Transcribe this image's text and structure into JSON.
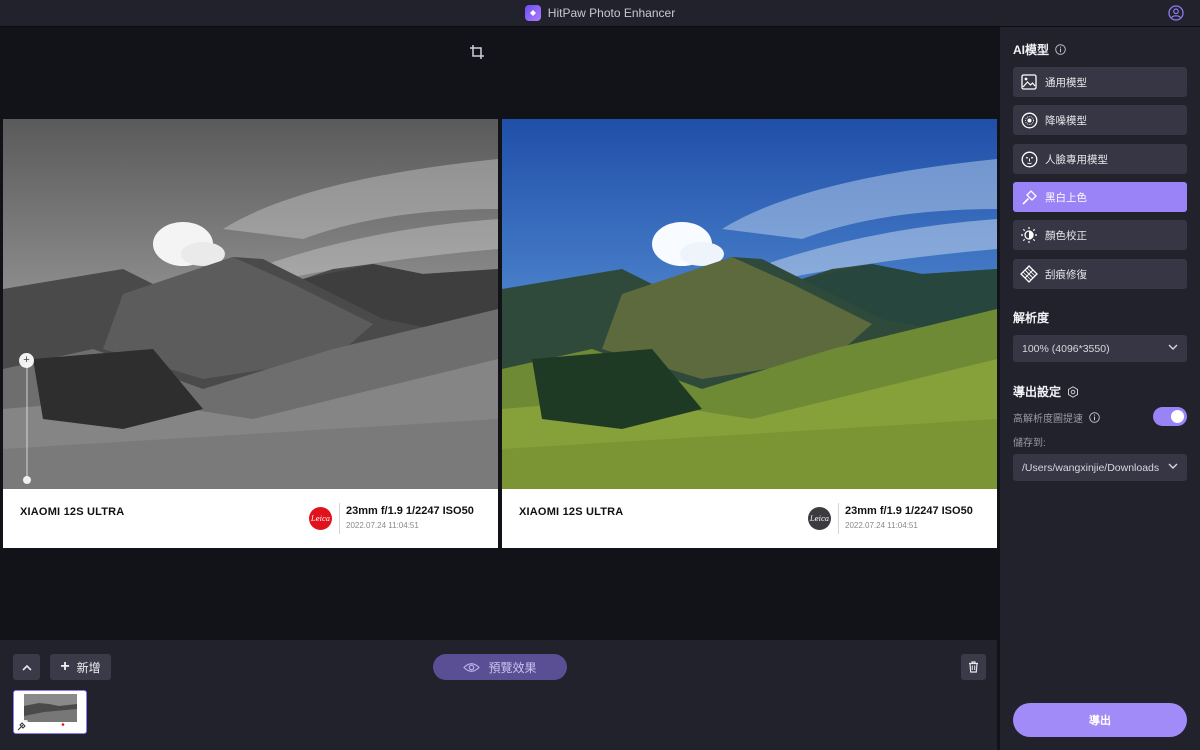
{
  "window": {
    "title": "HitPaw Photo Enhancer",
    "logo_icon": "hitpaw-logo-icon",
    "account_icon": "user-icon"
  },
  "canvas": {
    "toolbar_icon": "crop-icon",
    "zoom": {
      "in_label": "+",
      "out_label": "−"
    },
    "photos": [
      {
        "side": "original",
        "model": "XIAOMI 12S ULTRA",
        "brand": "Leica",
        "brand_color": "#e0121b",
        "params": "23mm  f/1.9  1/2247  ISO50",
        "date": "2022.07.24 11:04:51",
        "tone": "black-and-white"
      },
      {
        "side": "enhanced",
        "model": "XIAOMI 12S ULTRA",
        "brand": "Leica",
        "brand_color": "#3c3c40",
        "params": "23mm  f/1.9  1/2247  ISO50",
        "date": "2022.07.24 11:04:51",
        "tone": "colorized"
      }
    ]
  },
  "bottombar": {
    "collapse_icon": "chevron-up-icon",
    "add_label": "新增",
    "preview_label": "預覽效果",
    "delete_icon": "trash-icon"
  },
  "sidepanel": {
    "ai_model_title": "AI模型",
    "models": [
      {
        "label": "通用模型",
        "icon": "image-icon",
        "active": false
      },
      {
        "label": "降噪模型",
        "icon": "denoise-icon",
        "active": false
      },
      {
        "label": "人臉專用模型",
        "icon": "face-icon",
        "active": false
      },
      {
        "label": "黑白上色",
        "icon": "colorize-icon",
        "active": true
      },
      {
        "label": "顏色校正",
        "icon": "brightness-icon",
        "active": false
      },
      {
        "label": "刮痕修復",
        "icon": "scratch-repair-icon",
        "active": false
      }
    ],
    "resolution_title": "解析度",
    "resolution_value": "100% (4096*3550)",
    "export_settings_title": "導出設定",
    "hires_label": "高解析度圖提速",
    "hires_enabled": true,
    "save_to_label": "儲存到:",
    "save_path": "/Users/wangxinjie/Downloads",
    "export_label": "導出"
  },
  "colors": {
    "accent": "#9a83f7",
    "panel": "#22222c",
    "canvas": "#121219"
  }
}
